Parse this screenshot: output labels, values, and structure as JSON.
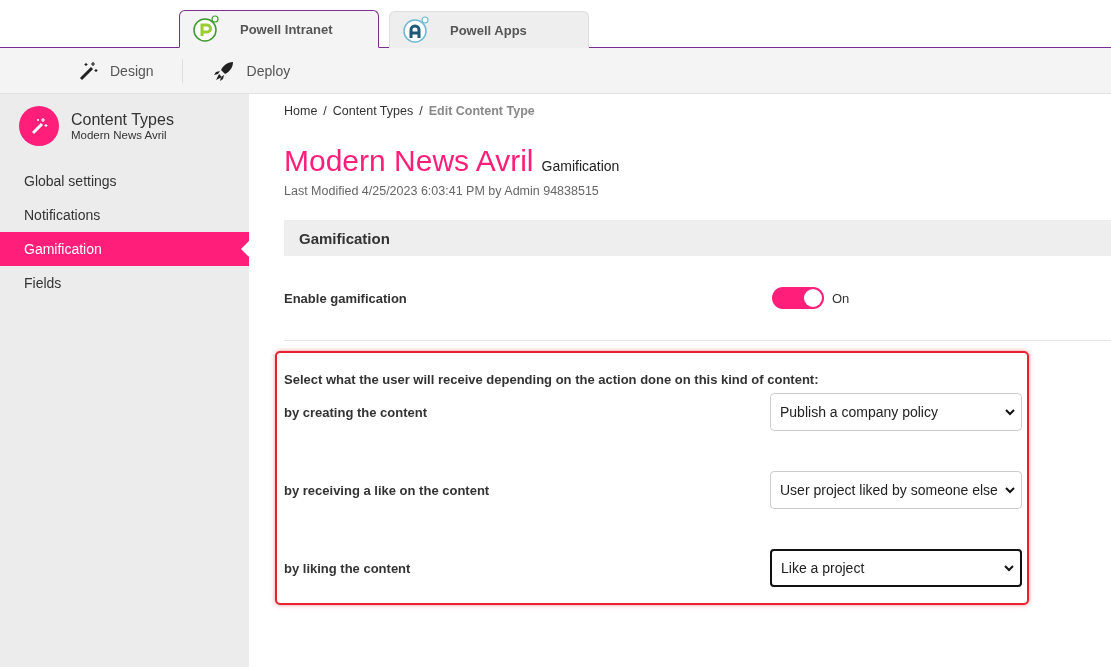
{
  "app_tabs": [
    {
      "label": "Powell Intranet",
      "kind": "intranet",
      "selected": true
    },
    {
      "label": "Powell Apps",
      "kind": "apps",
      "selected": false
    }
  ],
  "toolbar": [
    {
      "label": "Design",
      "kind": "wand"
    },
    {
      "label": "Deploy",
      "kind": "rocket"
    }
  ],
  "sidebar": {
    "title": "Content Types",
    "subtitle": "Modern News Avril",
    "items": [
      {
        "label": "Global settings",
        "selected": false
      },
      {
        "label": "Notifications",
        "selected": false
      },
      {
        "label": "Gamification",
        "selected": true
      },
      {
        "label": "Fields",
        "selected": false
      }
    ]
  },
  "breadcrumb": [
    {
      "label": "Home",
      "current": false
    },
    {
      "label": "Content Types",
      "current": false
    },
    {
      "label": "Edit Content Type",
      "current": true
    }
  ],
  "breadcrumb_separator": "/",
  "page": {
    "title": "Modern News Avril",
    "subtitle": "Gamification",
    "meta": "Last Modified 4/25/2023 6:03:41 PM by Admin 94838515"
  },
  "section": {
    "title": "Gamification"
  },
  "enable": {
    "label": "Enable gamification",
    "on": true,
    "state_label": "On"
  },
  "actions": {
    "intro": "Select what the user will receive depending on the action done on this kind of content:",
    "rows": [
      {
        "label": "by creating the content",
        "value": "Publish a company policy",
        "focused": false
      },
      {
        "label": "by receiving a like on the content",
        "value": "User project liked by someone else",
        "focused": false
      },
      {
        "label": "by liking the content",
        "value": "Like a project",
        "focused": true
      }
    ]
  }
}
